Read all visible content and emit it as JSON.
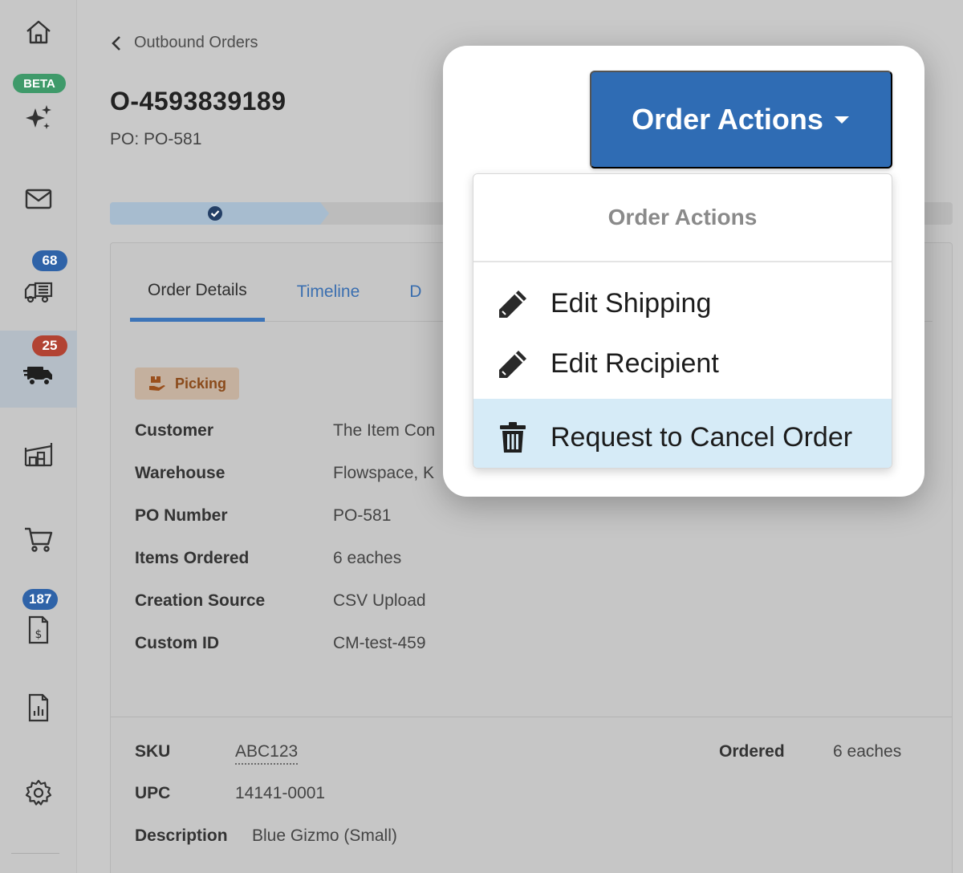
{
  "sidebar": {
    "items": [
      {
        "name": "home",
        "icon": "home-icon"
      },
      {
        "name": "ai",
        "icon": "sparkle-icon",
        "badge": "BETA"
      },
      {
        "name": "messages",
        "icon": "mail-icon"
      },
      {
        "name": "inbound",
        "icon": "truck-load-icon",
        "badge": "68"
      },
      {
        "name": "outbound",
        "icon": "delivery-truck-icon",
        "badge": "25"
      },
      {
        "name": "warehouse",
        "icon": "warehouse-icon"
      },
      {
        "name": "cart",
        "icon": "cart-icon"
      },
      {
        "name": "billing",
        "icon": "invoice-icon",
        "badge": "187"
      },
      {
        "name": "reports",
        "icon": "report-icon"
      },
      {
        "name": "settings",
        "icon": "gear-icon"
      }
    ]
  },
  "breadcrumb": {
    "label": "Outbound Orders"
  },
  "order": {
    "id": "O-4593839189",
    "po_line": "PO: PO-581",
    "status": "Picking"
  },
  "tabs": [
    {
      "label": "Order Details"
    },
    {
      "label": "Timeline"
    },
    {
      "label": "D"
    }
  ],
  "details": [
    {
      "label": "Customer",
      "value": "The Item Con"
    },
    {
      "label": "Warehouse",
      "value": "Flowspace, K"
    },
    {
      "label": "PO Number",
      "value": "PO-581"
    },
    {
      "label": "Items Ordered",
      "value": "6 eaches"
    },
    {
      "label": "Creation Source",
      "value": "CSV Upload"
    },
    {
      "label": "Custom ID",
      "value": "CM-test-459"
    }
  ],
  "line_item": {
    "sku_label": "SKU",
    "sku": "ABC123",
    "upc_label": "UPC",
    "upc": "14141-0001",
    "description_label": "Description",
    "description": "Blue Gizmo (Small)",
    "ordered_label": "Ordered",
    "ordered": "6 eaches"
  },
  "actions": {
    "button_label": "Order Actions",
    "menu_header": "Order Actions",
    "items": [
      {
        "label": "Edit Shipping",
        "icon": "pencil-icon"
      },
      {
        "label": "Edit Recipient",
        "icon": "pencil-icon"
      },
      {
        "label": "Request to Cancel Order",
        "icon": "trash-icon"
      }
    ]
  },
  "colors": {
    "primary": "#2f6cb4",
    "highlight": "#d6ebf7",
    "badge_blue": "#2f63a8",
    "badge_red": "#b24333",
    "badge_green": "#3f9a6a"
  }
}
